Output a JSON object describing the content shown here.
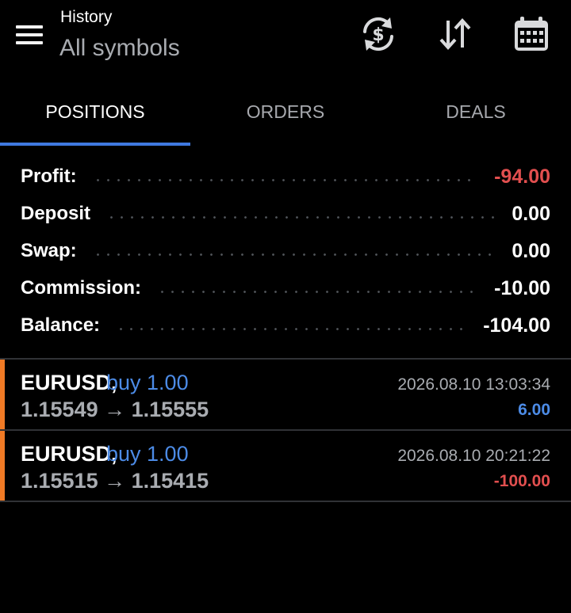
{
  "header": {
    "title": "History",
    "subtitle": "All symbols",
    "icons": [
      "menu-icon",
      "currency-refresh-icon",
      "sort-icon",
      "calendar-icon"
    ]
  },
  "tabs": [
    {
      "label": "POSITIONS",
      "active": true
    },
    {
      "label": "ORDERS",
      "active": false
    },
    {
      "label": "DEALS",
      "active": false
    }
  ],
  "summary": [
    {
      "label": "Profit:",
      "value": "-94.00"
    },
    {
      "label": "Deposit",
      "value": "0.00"
    },
    {
      "label": "Swap:",
      "value": "0.00"
    },
    {
      "label": "Commission:",
      "value": "-10.00"
    },
    {
      "label": "Balance:",
      "value": "-104.00"
    }
  ],
  "deals": [
    {
      "symbol": "EURUSD,",
      "type": "buy 1.00",
      "prices": "1.15549 → 1.15555",
      "time": "2026.08.10 13:03:34",
      "profit": "6.00"
    },
    {
      "symbol": "EURUSD,",
      "type": "buy 1.00",
      "prices": "1.15515 → 1.15415",
      "time": "2026.08.10 20:21:22",
      "profit": "-100.00"
    }
  ],
  "colors": {
    "background": "#000000",
    "accent_blue": "#3f79e0",
    "buy_blue": "#4c8be6",
    "loss_red": "#e24f4f",
    "row_marker_orange": "#f07a25",
    "muted_text": "#a9acb1"
  }
}
